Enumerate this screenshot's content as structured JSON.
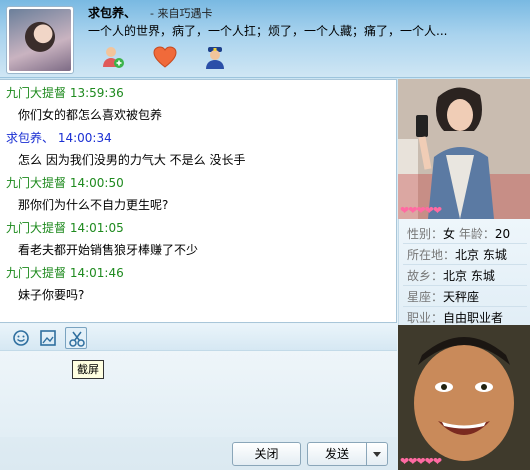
{
  "header": {
    "contact_name": "求包养、",
    "contact_source": "- 来自巧遇卡",
    "signature": "一个人的世界，病了，一个人扛；烦了，一个人藏；痛了，一个人...",
    "tools": [
      {
        "name": "add-friend-icon"
      },
      {
        "name": "heart-icon"
      },
      {
        "name": "police-icon"
      }
    ]
  },
  "messages": [
    {
      "sender": "九门大提督",
      "time": "13:59:36",
      "color": "#1e8a1e",
      "text": "你们女的都怎么喜欢被包养"
    },
    {
      "sender": "求包养、",
      "time": "14:00:34",
      "color": "#1a2fd3",
      "text": "怎么  因为我们没男的力气大  不是么  没长手"
    },
    {
      "sender": "九门大提督",
      "time": "14:00:50",
      "color": "#1e8a1e",
      "text": "那你们为什么不自力更生呢?"
    },
    {
      "sender": "九门大提督",
      "time": "14:01:05",
      "color": "#1e8a1e",
      "text": "看老夫都开始销售狼牙棒赚了不少"
    },
    {
      "sender": "九门大提督",
      "time": "14:01:46",
      "color": "#1e8a1e",
      "text": "妹子你要吗?"
    }
  ],
  "toolbar": {
    "tooltip": "截屏",
    "icons": [
      "smiley-icon",
      "image-icon",
      "scissors-icon"
    ]
  },
  "buttons": {
    "close": "关闭",
    "send": "发送"
  },
  "profile": {
    "gender_label": "性别：",
    "gender": "女",
    "age_label": "年龄：",
    "age": "20",
    "location_label": "所在地：",
    "location": "北京  东城",
    "hometown_label": "故乡：",
    "hometown": "北京  东城",
    "zodiac_label": "星座：",
    "zodiac": "天秤座",
    "job_label": "职业：",
    "job": "自由职业者"
  },
  "hearts": "❤❤❤❤❤"
}
